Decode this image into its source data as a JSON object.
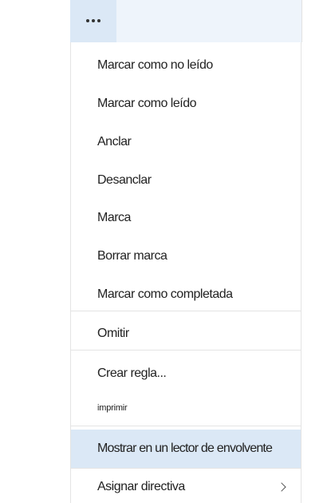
{
  "toolbar": {
    "more_icon": "more-horizontal-icon"
  },
  "menu": {
    "items": [
      {
        "label": "Marcar como no leído"
      },
      {
        "label": "Marcar como leído"
      },
      {
        "label": "Anclar"
      },
      {
        "label": "Desanclar"
      },
      {
        "label": "Marca"
      },
      {
        "label": "Borrar marca"
      },
      {
        "label": "Marcar como completada"
      },
      {
        "label": "Omitir"
      },
      {
        "label": "Crear regla..."
      },
      {
        "label": "imprimir"
      },
      {
        "label": "Mostrar en un lector de envolvente"
      },
      {
        "label": "Asignar directiva",
        "submenu_icon": "chevron-right-icon"
      }
    ]
  },
  "colors": {
    "highlight": "#dbe8f6",
    "top_bar": "#eef4fb",
    "separator": "#e4e4e4",
    "text": "#222222"
  }
}
